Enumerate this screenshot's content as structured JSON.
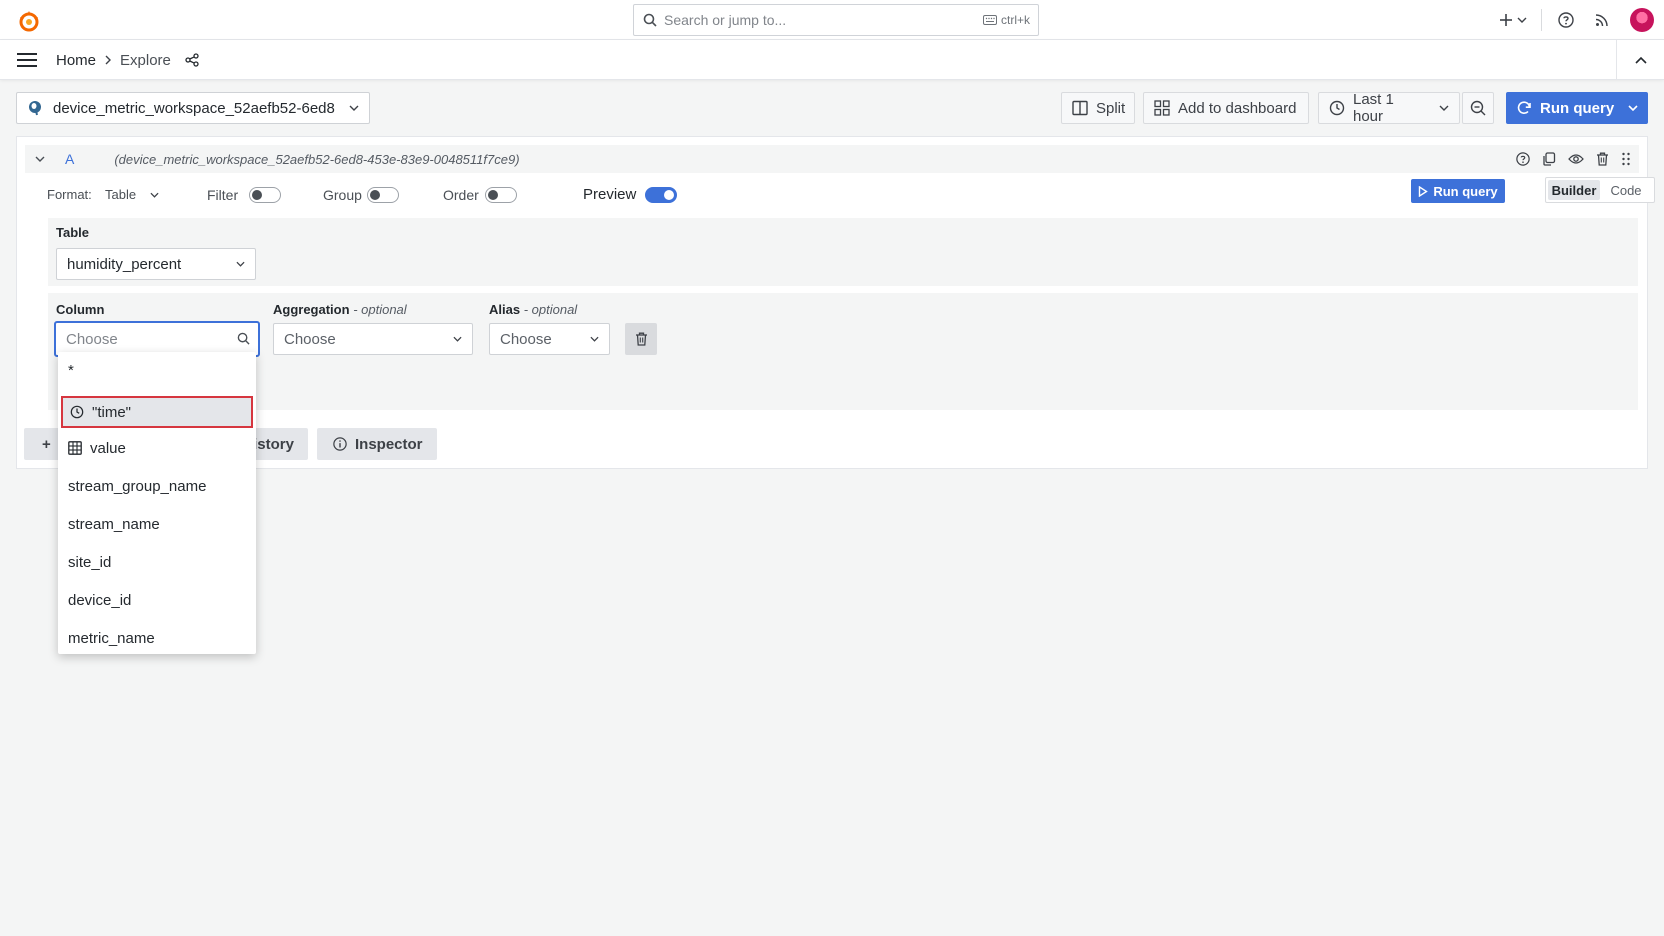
{
  "topbar": {
    "search_placeholder": "Search or jump to...",
    "shortcut": "ctrl+k"
  },
  "navbar": {
    "breadcrumb_home": "Home",
    "breadcrumb_current": "Explore"
  },
  "toolbar": {
    "datasource": "device_metric_workspace_52aefb52-6ed8",
    "split_label": "Split",
    "add_to_dashboard_label": "Add to dashboard",
    "time_range_label": "Last 1 hour",
    "run_query_label": "Run query"
  },
  "query": {
    "ref_id": "A",
    "datasource_full": "(device_metric_workspace_52aefb52-6ed8-453e-83e9-0048511f7ce9)",
    "format_label": "Format:",
    "format_value": "Table",
    "filter_label": "Filter",
    "filter_on": false,
    "group_label": "Group",
    "group_on": false,
    "order_label": "Order",
    "order_on": false,
    "preview_label": "Preview",
    "preview_on": true,
    "run_query_label": "Run query",
    "mode_builder": "Builder",
    "mode_code": "Code",
    "active_mode": "Builder",
    "table_label": "Table",
    "table_value": "humidity_percent",
    "column_label": "Column",
    "column_placeholder": "Choose",
    "aggregation_label": "Aggregation",
    "aggregation_optional": "- optional",
    "aggregation_placeholder": "Choose",
    "alias_label": "Alias",
    "alias_optional": "- optional",
    "alias_placeholder": "Choose"
  },
  "bottom_buttons": {
    "add_symbol": "+",
    "history_partial": "istory",
    "inspector_label": "Inspector"
  },
  "column_dropdown": {
    "items": [
      {
        "label": "*",
        "icon": ""
      },
      {
        "label": "\"time\"",
        "icon": "clock-icon",
        "highlighted": true
      },
      {
        "label": "value",
        "icon": "table-grid-icon"
      },
      {
        "label": "stream_group_name",
        "icon": ""
      },
      {
        "label": "stream_name",
        "icon": ""
      },
      {
        "label": "site_id",
        "icon": ""
      },
      {
        "label": "device_id",
        "icon": ""
      },
      {
        "label": "metric_name",
        "icon": ""
      }
    ]
  },
  "colors": {
    "primary": "#3d71d9",
    "highlight_border": "#d6363f",
    "logo": "#f46800"
  }
}
